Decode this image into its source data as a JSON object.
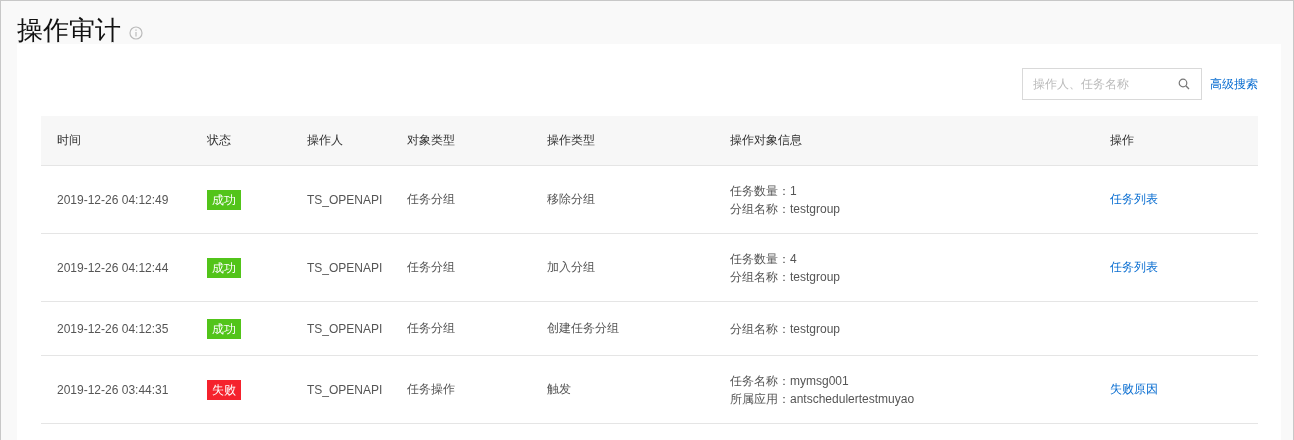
{
  "page": {
    "title": "操作审计"
  },
  "search": {
    "placeholder": "操作人、任务名称",
    "advanced_link": "高级搜索"
  },
  "table": {
    "columns": [
      "时间",
      "状态",
      "操作人",
      "对象类型",
      "操作类型",
      "操作对象信息",
      "操作"
    ],
    "rows": [
      {
        "time": "2019-12-26 04:12:49",
        "status": {
          "text": "成功",
          "kind": "success"
        },
        "operator": "TS_OPENAPI",
        "object_type": "任务分组",
        "operation_type": "移除分组",
        "info": [
          "任务数量：1",
          "分组名称：testgroup"
        ],
        "action": "任务列表"
      },
      {
        "time": "2019-12-26 04:12:44",
        "status": {
          "text": "成功",
          "kind": "success"
        },
        "operator": "TS_OPENAPI",
        "object_type": "任务分组",
        "operation_type": "加入分组",
        "info": [
          "任务数量：4",
          "分组名称：testgroup"
        ],
        "action": "任务列表"
      },
      {
        "time": "2019-12-26 04:12:35",
        "status": {
          "text": "成功",
          "kind": "success"
        },
        "operator": "TS_OPENAPI",
        "object_type": "任务分组",
        "operation_type": "创建任务分组",
        "info": [
          "分组名称：testgroup"
        ]
      },
      {
        "time": "2019-12-26 03:44:31",
        "status": {
          "text": "失败",
          "kind": "failure"
        },
        "operator": "TS_OPENAPI",
        "object_type": "任务操作",
        "operation_type": "触发",
        "info": [
          "任务名称：mymsg001",
          "所属应用：antschedulertestmuyao"
        ],
        "action": "失败原因"
      }
    ]
  }
}
